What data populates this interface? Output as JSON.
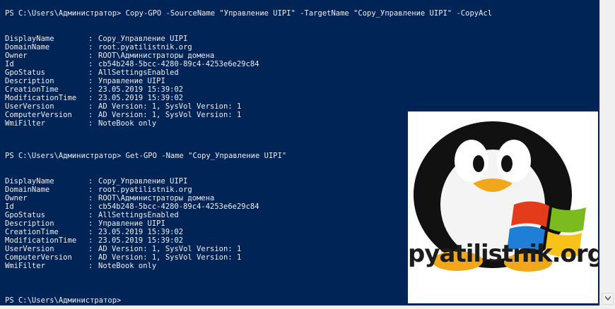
{
  "console": {
    "blocks": [
      {
        "prompt": "PS C:\\Users\\Администратор> Copy-GPO -SourceName \"Управление UIPI\" -TargetName \"Copy_Управление UIPI\" -CopyAcl",
        "rows": [
          {
            "name": "DisplayName",
            "value": "Copy_Управление UIPI"
          },
          {
            "name": "DomainName",
            "value": "root.pyatilistnik.org"
          },
          {
            "name": "Owner",
            "value": "ROOT\\Администраторы домена"
          },
          {
            "name": "Id",
            "value": "cb54b248-5bcc-4280-89c4-4253e6e29c84"
          },
          {
            "name": "GpoStatus",
            "value": "AllSettingsEnabled"
          },
          {
            "name": "Description",
            "value": "Управление UIPI"
          },
          {
            "name": "CreationTime",
            "value": "23.05.2019 15:39:02"
          },
          {
            "name": "ModificationTime",
            "value": "23.05.2019 15:39:02"
          },
          {
            "name": "UserVersion",
            "value": "AD Version: 1, SysVol Version: 1"
          },
          {
            "name": "ComputerVersion",
            "value": "AD Version: 1, SysVol Version: 1"
          },
          {
            "name": "WmiFilter",
            "value": "NoteBook only"
          }
        ]
      },
      {
        "prompt": "PS C:\\Users\\Администратор> Get-GPO -Name \"Copy_Управление UIPI\"",
        "rows": [
          {
            "name": "DisplayName",
            "value": "Copy_Управление UIPI"
          },
          {
            "name": "DomainName",
            "value": "root.pyatilistnik.org"
          },
          {
            "name": "Owner",
            "value": "ROOT\\Администраторы домена"
          },
          {
            "name": "Id",
            "value": "cb54b248-5bcc-4280-89c4-4253e6e29c84"
          },
          {
            "name": "GpoStatus",
            "value": "AllSettingsEnabled"
          },
          {
            "name": "Description",
            "value": "Управление UIPI"
          },
          {
            "name": "CreationTime",
            "value": "23.05.2019 15:39:02"
          },
          {
            "name": "ModificationTime",
            "value": "23.05.2019 15:39:02"
          },
          {
            "name": "UserVersion",
            "value": "AD Version: 1, SysVol Version: 1"
          },
          {
            "name": "ComputerVersion",
            "value": "AD Version: 1, SysVol Version: 1"
          },
          {
            "name": "WmiFilter",
            "value": "NoteBook only"
          }
        ]
      }
    ],
    "final_prompt": "PS C:\\Users\\Администратор>",
    "separator": ":",
    "background": "#012456",
    "foreground": "#eeedf0"
  },
  "logo": {
    "text": "pyatilistnik.org",
    "icon": "penguin-with-windows-flag-icon",
    "flag_colors": [
      "#e43b1b",
      "#7cbb1e",
      "#1f7fd6",
      "#f8c21b"
    ]
  }
}
